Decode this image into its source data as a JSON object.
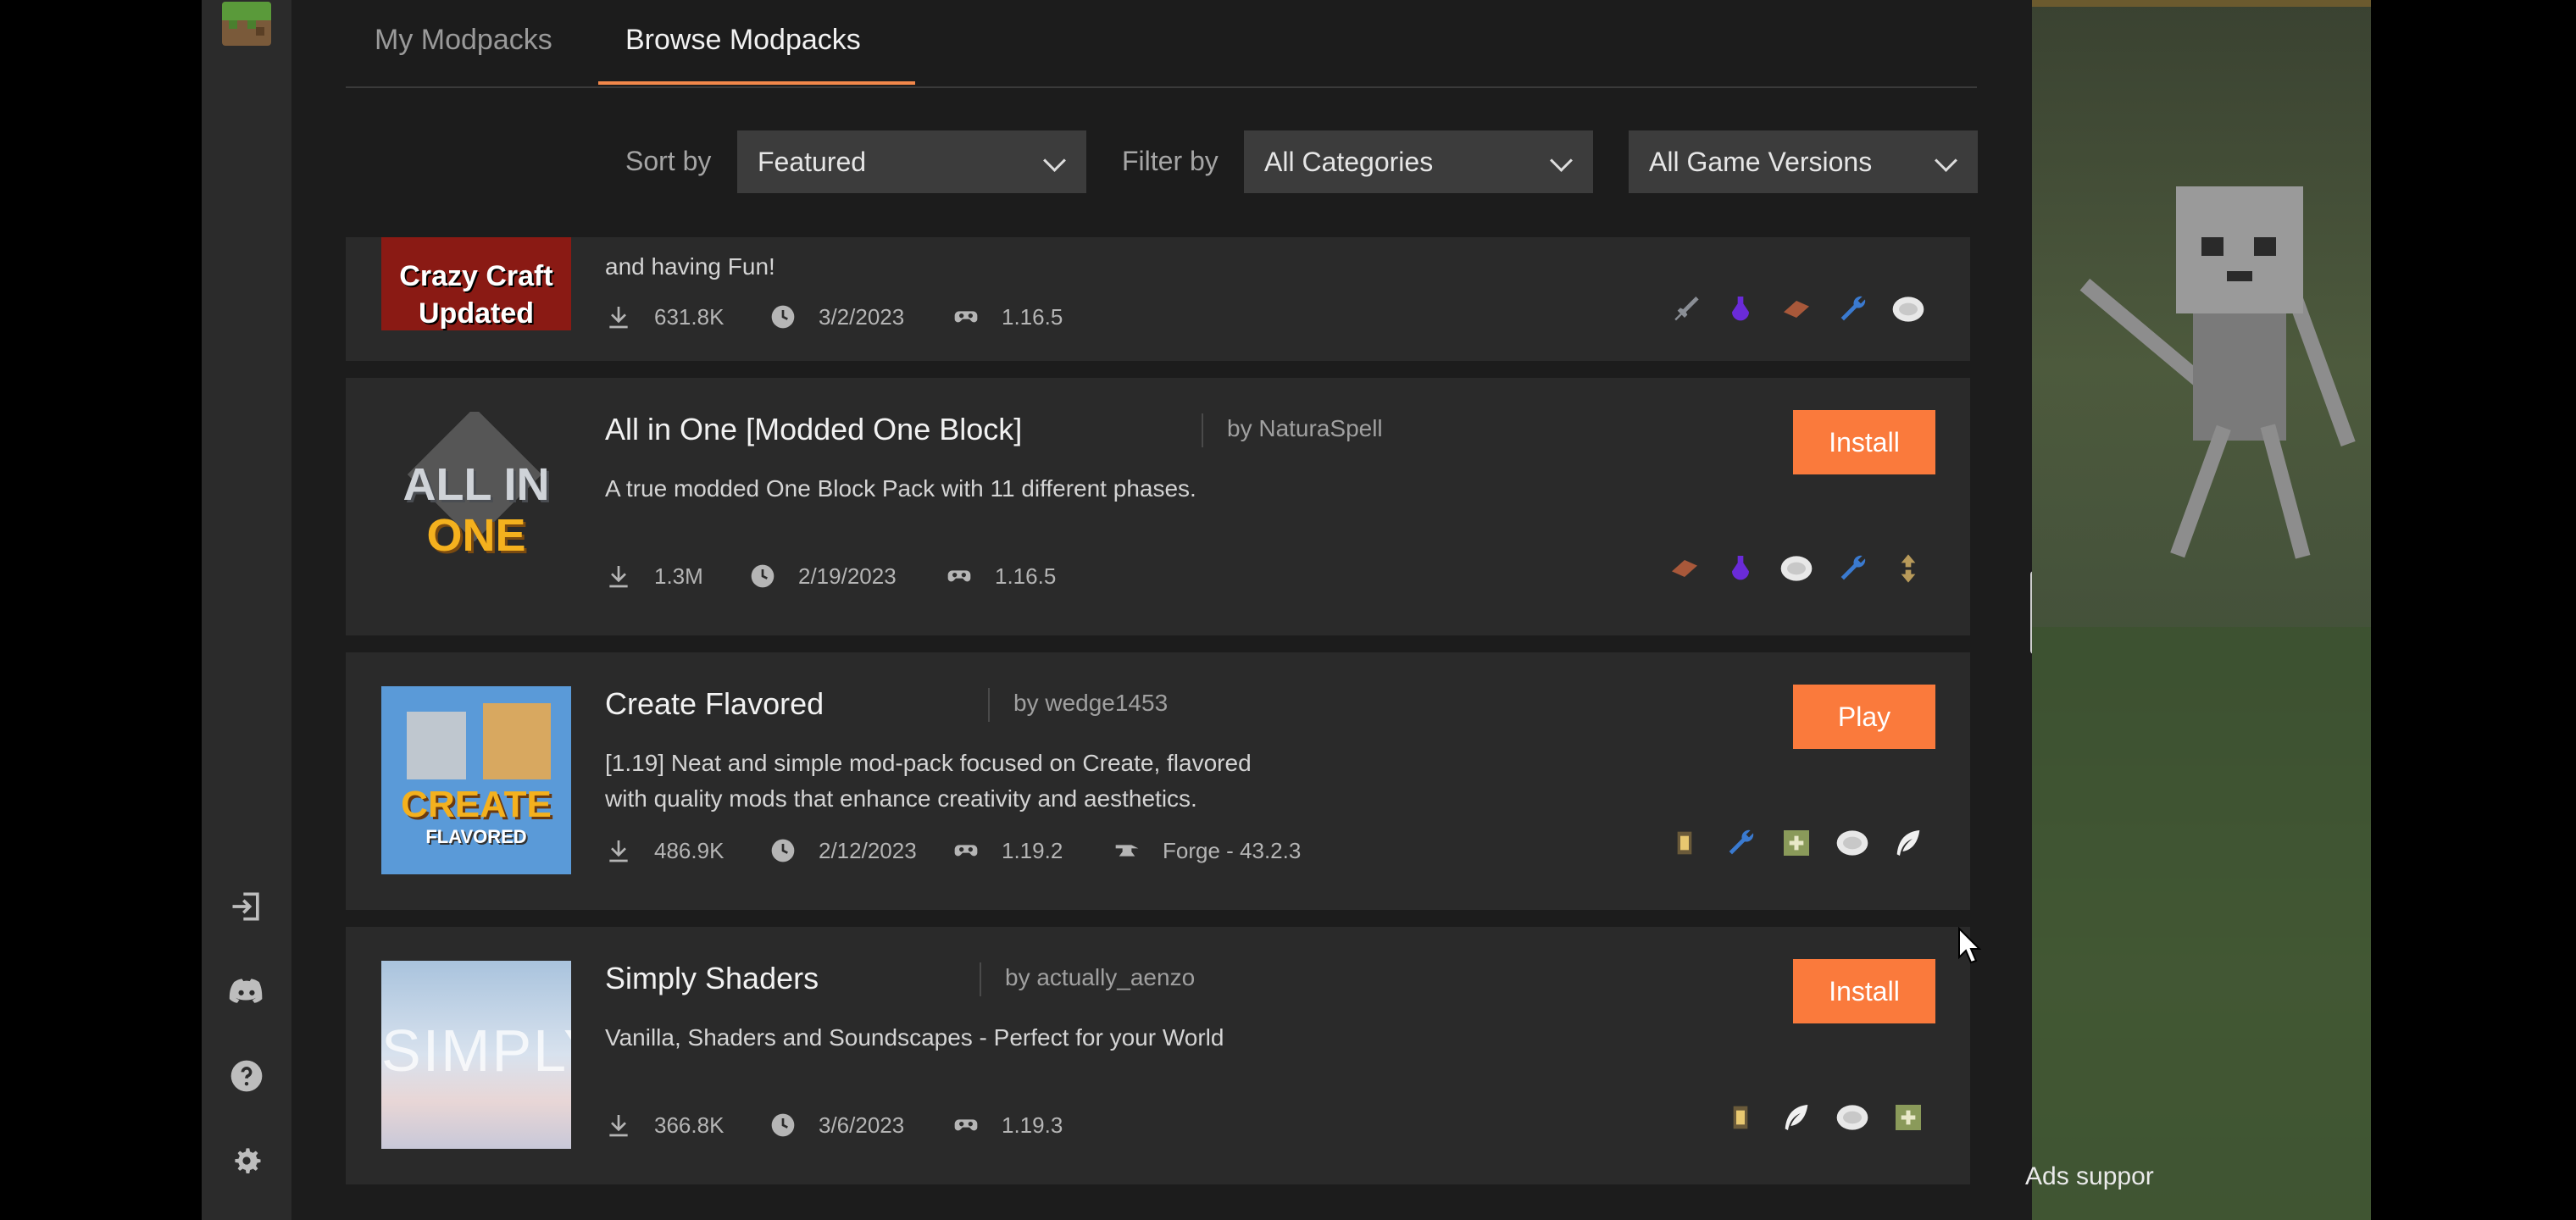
{
  "tabs": {
    "my_modpacks": "My Modpacks",
    "browse_modpacks": "Browse Modpacks"
  },
  "filters": {
    "sort_label": "Sort by",
    "sort_value": "Featured",
    "filter_label": "Filter by",
    "category_value": "All Categories",
    "version_value": "All Game Versions"
  },
  "sidebar": {
    "icons": [
      "minecraft-grass-icon",
      "login-icon",
      "discord-icon",
      "help-icon",
      "settings-icon"
    ]
  },
  "modpacks": [
    {
      "thumb_text": [
        "Crazy Craft",
        "Updated"
      ],
      "description": "and having Fun!",
      "downloads": "631.8K",
      "date": "3/2/2023",
      "version": "1.16.5",
      "tags": [
        "sword-icon",
        "potion-icon",
        "brick-icon",
        "wrench-icon",
        "food-icon"
      ]
    },
    {
      "title": "All in One [Modded One Block]",
      "author": "by NaturaSpell",
      "thumb_text": [
        "ALL IN",
        "ONE"
      ],
      "description": "A true modded One Block Pack with 11 different phases.",
      "downloads": "1.3M",
      "date": "2/19/2023",
      "version": "1.16.5",
      "button": "Install",
      "tags": [
        "brick-icon",
        "potion-icon",
        "food-icon",
        "wrench-icon",
        "arrows-icon"
      ]
    },
    {
      "title": "Create Flavored",
      "author": "by wedge1453",
      "thumb_text": [
        "CREATE",
        "FLAVORED"
      ],
      "description_lines": [
        "[1.19] Neat and simple mod-pack focused on Create, flavored",
        "with quality mods that enhance creativity and aesthetics."
      ],
      "downloads": "486.9K",
      "date": "2/12/2023",
      "version": "1.19.2",
      "loader": "Forge - 43.2.3",
      "button": "Play",
      "tags": [
        "lantern-icon",
        "wrench-icon",
        "map-icon",
        "food-icon",
        "feather-icon"
      ]
    },
    {
      "title": "Simply Shaders",
      "author": "by actually_aenzo",
      "thumb_text": [
        "SIMPLY"
      ],
      "description": "Vanilla, Shaders and Soundscapes - Perfect for your World",
      "downloads": "366.8K",
      "date": "3/6/2023",
      "version": "1.19.3",
      "button": "Install",
      "tags": [
        "lantern-icon",
        "feather-icon",
        "food-icon",
        "map-icon"
      ]
    }
  ],
  "ads": "Ads suppor",
  "colors": {
    "accent": "#fa7a3c",
    "card": "#2a2a2a",
    "background": "#1c1c1c",
    "sidebar": "#2b2b2b"
  }
}
